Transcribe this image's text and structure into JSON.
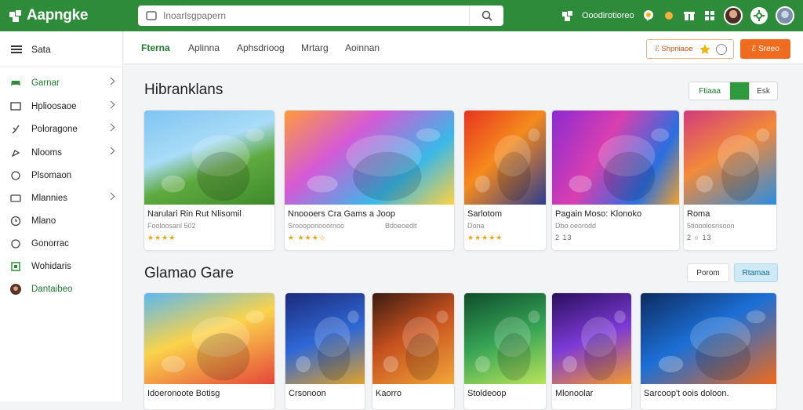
{
  "app": {
    "logo_text": "Aapngke",
    "search_placeholder": "Inoarlsgpapern",
    "top_label": "Ooodirotioreo"
  },
  "sidebar": {
    "header": "Sata",
    "items": [
      {
        "label": "Garnar",
        "icon": "gamepad-icon",
        "chevron": true,
        "active": true
      },
      {
        "label": "Hplioosaoe",
        "icon": "monitor-icon",
        "chevron": true
      },
      {
        "label": "Poloragone",
        "icon": "pin-icon",
        "chevron": true
      },
      {
        "label": "Nlooms",
        "icon": "compass-icon",
        "chevron": true
      },
      {
        "label": "Plsomaon",
        "icon": "circle-icon",
        "chevron": false
      },
      {
        "label": "Mlannies",
        "icon": "film-icon",
        "chevron": true
      },
      {
        "label": "Mlano",
        "icon": "clock-icon",
        "chevron": false
      },
      {
        "label": "Gonorrac",
        "icon": "circle-icon",
        "chevron": false
      },
      {
        "label": "Wohidaris",
        "icon": "square-icon",
        "chevron": false
      },
      {
        "label": "Dantaibeo",
        "icon": "avatar-icon",
        "chevron": false,
        "active": true
      }
    ]
  },
  "tabs": [
    {
      "label": "Fterna",
      "active": true
    },
    {
      "label": "Aplinna"
    },
    {
      "label": "Aphsdrioog"
    },
    {
      "label": "Mrtarg"
    },
    {
      "label": "Aoinnan"
    }
  ],
  "actions": {
    "secondary_label": "ℰ Shpriiaoe",
    "primary_label": "ℰ Sreeo"
  },
  "section1": {
    "title": "Hibranklans",
    "seg_labels": [
      "Ftiaaa",
      "",
      "Esk"
    ],
    "cards": [
      {
        "title": "Narulari Rin Rut Nlisomil",
        "sub": "Fooloosanl 502",
        "stars": "★★★★"
      },
      {
        "title": "Nnoooers Cra Gams a Joop",
        "sub": "Sroooponooornoo",
        "sub2": "Bdoeoedit",
        "stars": "★ ★★★☆"
      },
      {
        "title": "Sarlotom",
        "sub": "Dona",
        "stars": "★★★★★"
      },
      {
        "title": "Pagain Moso: Klonoko",
        "sub": "Dbo oeorodd",
        "stars": "2 13"
      },
      {
        "title": "Roma",
        "sub": "5tiooolosrisoon",
        "stars": "2 ○ 13"
      }
    ]
  },
  "section2": {
    "title": "Glamao Gare",
    "seg_labels": [
      "Porom",
      "Rtamaa"
    ],
    "cards": [
      {
        "title": "Idoeronoote Botisg"
      },
      {
        "title": "Crsonoon"
      },
      {
        "title": "Kaorro"
      },
      {
        "title": "Stoldeoop"
      },
      {
        "title": "Mlonoolar"
      },
      {
        "title": "Sarcoop't oois doloon."
      }
    ]
  },
  "colors": {
    "brand_green": "#2e8b3a",
    "accent_orange": "#ef6c1e",
    "star": "#e8a417"
  }
}
